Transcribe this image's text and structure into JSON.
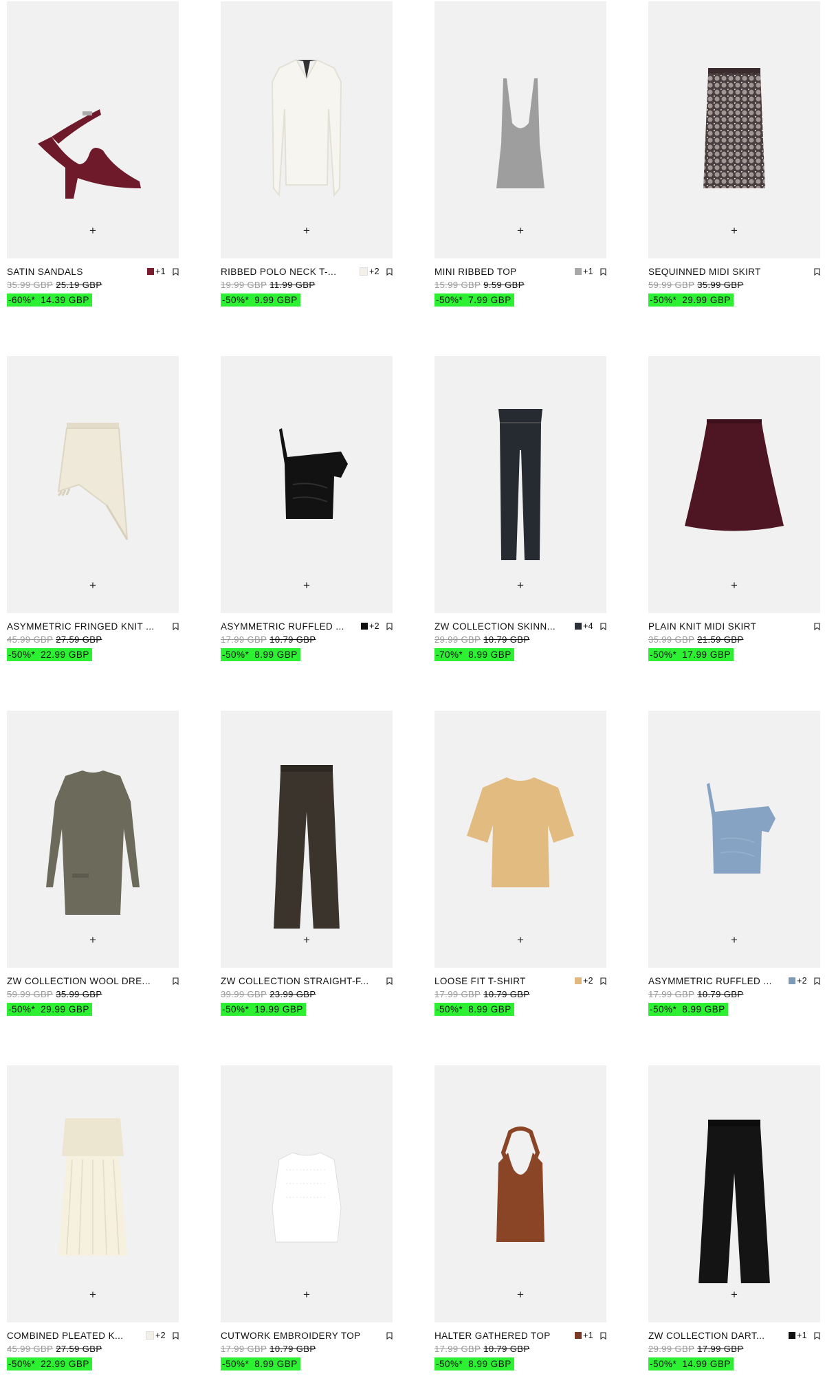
{
  "ui": {
    "add_icon": "plus-icon",
    "bookmark_icon": "bookmark-icon",
    "sale_color": "#2df033"
  },
  "products": [
    {
      "name": "SATIN SANDALS",
      "swatch": "#7a1d2e",
      "more": "+1",
      "old1": "35.99 GBP",
      "old2": "25.19 GBP",
      "pct": "-60%*",
      "price": "14.39 GBP",
      "art": "sandal",
      "c": "#6e1a2a"
    },
    {
      "name": "RIBBED POLO NECK T-...",
      "swatch": "#f2f0e8",
      "more": "+2",
      "old1": "19.99 GBP",
      "old2": "11.99 GBP",
      "pct": "-50%*",
      "price": "9.99 GBP",
      "art": "polo",
      "c": "#f7f5ef"
    },
    {
      "name": "MINI RIBBED TOP",
      "swatch": "#a8a8a8",
      "more": "+1",
      "old1": "15.99 GBP",
      "old2": "9.59 GBP",
      "pct": "-50%*",
      "price": "7.99 GBP",
      "art": "tank",
      "c": "#9e9e9e"
    },
    {
      "name": "SEQUINNED MIDI SKIRT",
      "swatch": "",
      "more": "",
      "old1": "59.99 GBP",
      "old2": "35.99 GBP",
      "pct": "-50%*",
      "price": "29.99 GBP",
      "art": "sequin",
      "c": "#4a3f40"
    },
    {
      "name": "ASYMMETRIC FRINGED KNIT ...",
      "swatch": "",
      "more": "",
      "old1": "45.99 GBP",
      "old2": "27.59 GBP",
      "pct": "-50%*",
      "price": "22.99 GBP",
      "art": "fringe",
      "c": "#efe9da"
    },
    {
      "name": "ASYMMETRIC RUFFLED ...",
      "swatch": "#111111",
      "more": "+2",
      "old1": "17.99 GBP",
      "old2": "10.79 GBP",
      "pct": "-50%*",
      "price": "8.99 GBP",
      "art": "oneshoulder",
      "c": "#121212"
    },
    {
      "name": "ZW COLLECTION SKINN...",
      "swatch": "#2b3038",
      "more": "+4",
      "old1": "29.99 GBP",
      "old2": "10.79 GBP",
      "pct": "-70%*",
      "price": "8.99 GBP",
      "art": "jeans",
      "c": "#262b31"
    },
    {
      "name": "PLAIN KNIT MIDI SKIRT",
      "swatch": "",
      "more": "",
      "old1": "35.99 GBP",
      "old2": "21.59 GBP",
      "pct": "-50%*",
      "price": "17.99 GBP",
      "art": "aline",
      "c": "#4e1623"
    },
    {
      "name": "ZW COLLECTION WOOL DRE...",
      "swatch": "",
      "more": "",
      "old1": "59.99 GBP",
      "old2": "35.99 GBP",
      "pct": "-50%*",
      "price": "29.99 GBP",
      "art": "dress",
      "c": "#6b6a5b"
    },
    {
      "name": "ZW COLLECTION STRAIGHT-F...",
      "swatch": "",
      "more": "",
      "old1": "39.99 GBP",
      "old2": "23.99 GBP",
      "pct": "-50%*",
      "price": "19.99 GBP",
      "art": "trousers",
      "c": "#3a342c"
    },
    {
      "name": "LOOSE FIT T-SHIRT",
      "swatch": "#e0b97e",
      "more": "+2",
      "old1": "17.99 GBP",
      "old2": "10.79 GBP",
      "pct": "-50%*",
      "price": "8.99 GBP",
      "art": "tee",
      "c": "#e2bb80"
    },
    {
      "name": "ASYMMETRIC RUFFLED ...",
      "swatch": "#7d9ab8",
      "more": "+2",
      "old1": "17.99 GBP",
      "old2": "10.79 GBP",
      "pct": "-50%*",
      "price": "8.99 GBP",
      "art": "oneshoulder",
      "c": "#86a3c4"
    },
    {
      "name": "COMBINED PLEATED K...",
      "swatch": "#f2efe6",
      "more": "+2",
      "old1": "45.99 GBP",
      "old2": "27.59 GBP",
      "pct": "-50%*",
      "price": "22.99 GBP",
      "art": "pleated",
      "c": "#ece5cf"
    },
    {
      "name": "CUTWORK EMBROIDERY TOP",
      "swatch": "",
      "more": "",
      "old1": "17.99 GBP",
      "old2": "10.79 GBP",
      "pct": "-50%*",
      "price": "8.99 GBP",
      "art": "whitetop",
      "c": "#ffffff"
    },
    {
      "name": "HALTER GATHERED TOP",
      "swatch": "#7a3a25",
      "more": "+1",
      "old1": "17.99 GBP",
      "old2": "10.79 GBP",
      "pct": "-50%*",
      "price": "8.99 GBP",
      "art": "halter",
      "c": "#8a4527"
    },
    {
      "name": "ZW COLLECTION DART...",
      "swatch": "#111111",
      "more": "+1",
      "old1": "29.99 GBP",
      "old2": "17.99 GBP",
      "pct": "-50%*",
      "price": "14.99 GBP",
      "art": "widepants",
      "c": "#141414"
    }
  ]
}
